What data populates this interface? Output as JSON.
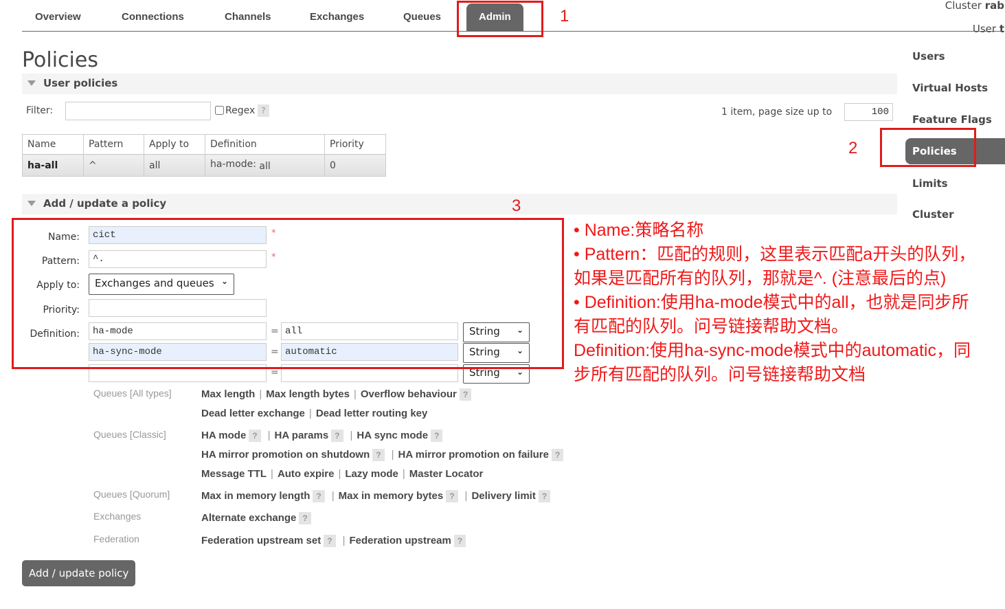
{
  "topnav": {
    "tabs": [
      {
        "label": "Overview"
      },
      {
        "label": "Connections"
      },
      {
        "label": "Channels"
      },
      {
        "label": "Exchanges"
      },
      {
        "label": "Queues"
      },
      {
        "label": "Admin",
        "active": true
      }
    ],
    "cluster_label": "Cluster ",
    "cluster_value": "rab",
    "user_label": "User ",
    "user_value": "t"
  },
  "sidenav": {
    "items": [
      {
        "label": "Users"
      },
      {
        "label": "Virtual Hosts"
      },
      {
        "label": "Feature Flags"
      },
      {
        "label": "Policies",
        "active": true
      },
      {
        "label": "Limits"
      },
      {
        "label": "Cluster"
      }
    ]
  },
  "page": {
    "title": "Policies",
    "user_policies": {
      "heading": "User policies",
      "filter_label": "Filter:",
      "filter_value": "",
      "regex_label": "Regex",
      "regex_checked": false,
      "help_glyph": "?",
      "paging_text": "1 item, page size up to",
      "page_size": "100",
      "table": {
        "columns": [
          "Name",
          "Pattern",
          "Apply to",
          "Definition",
          "Priority"
        ],
        "rows": [
          {
            "name": "ha-all",
            "pattern": "^",
            "apply_to": "all",
            "definition_key": "ha-mode:",
            "definition_value": "all",
            "priority": "0"
          }
        ]
      }
    },
    "add_policy": {
      "heading": "Add / update a policy",
      "name_label": "Name:",
      "name_value": "cict",
      "pattern_label": "Pattern:",
      "pattern_value": "^.",
      "required_mark": "*",
      "apply_label": "Apply to:",
      "apply_value": "Exchanges and queues",
      "priority_label": "Priority:",
      "priority_value": "",
      "definition_label": "Definition:",
      "eq": "=",
      "definitions": [
        {
          "key": "ha-mode",
          "value": "all",
          "type": "String"
        },
        {
          "key": "ha-sync-mode",
          "value": "automatic",
          "type": "String"
        },
        {
          "key": "",
          "value": "",
          "type": "String"
        }
      ],
      "helpers": [
        {
          "category": "Queues [All types]",
          "rows": [
            [
              {
                "label": "Max length"
              },
              {
                "label": "Max length bytes"
              },
              {
                "label": "Overflow behaviour",
                "help": true
              }
            ],
            [
              {
                "label": "Dead letter exchange"
              },
              {
                "label": "Dead letter routing key"
              }
            ]
          ]
        },
        {
          "category": "Queues [Classic]",
          "rows": [
            [
              {
                "label": "HA mode",
                "help": true
              },
              {
                "label": "HA params",
                "help": true
              },
              {
                "label": "HA sync mode",
                "help": true
              }
            ],
            [
              {
                "label": "HA mirror promotion on shutdown",
                "help": true
              },
              {
                "label": "HA mirror promotion on failure",
                "help": true
              }
            ],
            [
              {
                "label": "Message TTL"
              },
              {
                "label": "Auto expire"
              },
              {
                "label": "Lazy mode"
              },
              {
                "label": "Master Locator"
              }
            ]
          ]
        },
        {
          "category": "Queues [Quorum]",
          "rows": [
            [
              {
                "label": "Max in memory length",
                "help": true
              },
              {
                "label": "Max in memory bytes",
                "help": true
              },
              {
                "label": "Delivery limit",
                "help": true
              }
            ]
          ]
        },
        {
          "category": "Exchanges",
          "rows": [
            [
              {
                "label": "Alternate exchange",
                "help": true
              }
            ]
          ]
        },
        {
          "category": "Federation",
          "rows": [
            [
              {
                "label": "Federation upstream set",
                "help": true
              },
              {
                "label": "Federation upstream",
                "help": true
              }
            ]
          ]
        }
      ],
      "submit_label": "Add / update policy"
    }
  },
  "annotations": {
    "color": "#e01b1b",
    "markers": [
      "1",
      "2",
      "3"
    ],
    "notes": [
      "• Name:策略名称",
      "• Pattern：匹配的规则，这里表示匹配a开头的队列，如果是匹配所有的队列，那就是^. (注意最后的点)",
      "• Definition:使用ha-mode模式中的all，也就是同步所有匹配的队列。问号链接帮助文档。",
      "Definition:使用ha-sync-mode模式中的automatic，同步所有匹配的队列。问号链接帮助文档"
    ]
  }
}
